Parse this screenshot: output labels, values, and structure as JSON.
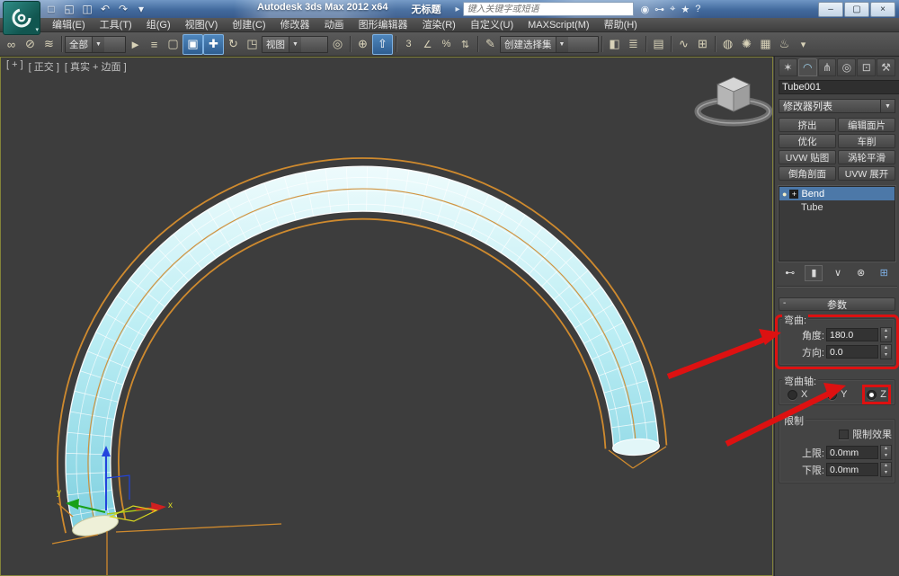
{
  "title_bar": {
    "app_title": "Autodesk 3ds Max 2012 x64",
    "document_title": "无标题",
    "search_placeholder": "键入关键字或短语"
  },
  "menu_bar": [
    "编辑(E)",
    "工具(T)",
    "组(G)",
    "视图(V)",
    "创建(C)",
    "修改器",
    "动画",
    "图形编辑器",
    "渲染(R)",
    "自定义(U)",
    "MAXScript(M)",
    "帮助(H)"
  ],
  "toolbar": {
    "selection_filter_value": "全部",
    "reference_coordinate_value": "视图",
    "selection_set_value": "创建选择集"
  },
  "viewport": {
    "label_general": "[ + ]",
    "label_pov": "[ 正交 ]",
    "label_shading": "[ 真实 + 边面 ]",
    "axis_x_label": "x",
    "axis_y_label": "y"
  },
  "command_panel": {
    "object_name": "Tube001",
    "modifier_list_label": "修改器列表",
    "modifier_buttons": [
      "挤出",
      "编辑面片",
      "优化",
      "车削",
      "UVW 贴图",
      "涡轮平滑",
      "倒角剖面",
      "UVW 展开"
    ],
    "modifier_stack": [
      {
        "label": "Bend"
      },
      {
        "label": "Tube"
      }
    ],
    "rollout_title": "参数",
    "bend_group": {
      "title": "弯曲:",
      "angle_label": "角度:",
      "angle_value": "180.0",
      "direction_label": "方向:",
      "direction_value": "0.0"
    },
    "axis_group": {
      "title": "弯曲轴:",
      "x": "X",
      "y": "Y",
      "z": "Z",
      "selected": "Z"
    },
    "limits_group": {
      "title": "限制",
      "effect_label": "限制效果",
      "upper_label": "上限:",
      "upper_value": "0.0mm",
      "lower_label": "下限:",
      "lower_value": "0.0mm"
    }
  },
  "icons": {
    "logo_caret": "▾",
    "new": "□",
    "open": "◱",
    "save": "◫",
    "undo": "↶",
    "redo": "↷",
    "qat_more": "▾",
    "search_expand": "▸",
    "search": "◉",
    "key": "⊶",
    "communicate": "⌖",
    "favorites": "★",
    "help": "?",
    "win_min": "–",
    "win_max": "▢",
    "win_close": "×",
    "link": "∞",
    "unlink": "⊘",
    "bind_spacewarp": "≋",
    "dd_arrow": "▼",
    "select": "►",
    "select_by_name": "≡",
    "region": "▢",
    "window_crossing": "▣",
    "move": "✚",
    "rotate": "↻",
    "scale": "◳",
    "pivot": "◎",
    "manipulate": "⊕",
    "kbd_override": "⇧",
    "snap": "3",
    "angle_snap": "∠",
    "percent_snap": "%",
    "spinner_snap": "⇅",
    "named_sets": "✎",
    "mirror": "◧",
    "align": "≣",
    "layers": "▤",
    "curve_editor": "∿",
    "schematic": "⊞",
    "material": "◍",
    "render_setup": "✺",
    "rendered_frame": "▦",
    "render": "♨",
    "render_more": "▾",
    "tab_create": "✶",
    "tab_modify": "◠",
    "tab_hierarchy": "⋔",
    "tab_motion": "◎",
    "tab_display": "⊡",
    "tab_utilities": "⚒",
    "bulb": "●",
    "plus_box": "+",
    "pin_stack": "⊷",
    "show_end_result": "▮",
    "make_unique": "∨",
    "remove_modifier": "⊗",
    "configure_sets": "⊞",
    "spin_up": "▴",
    "spin_down": "▾",
    "rollout_collapse": "-",
    "modlist_arrow": "▼"
  },
  "colors": {
    "annotation_red": "#dd1111",
    "tube_light": "#e6fafa",
    "tube_dark": "#7fd0e0",
    "gizmo_orange": "#cf8a2e",
    "selection_blue": "#4c78a8",
    "object_color": "#6fd6e8"
  }
}
